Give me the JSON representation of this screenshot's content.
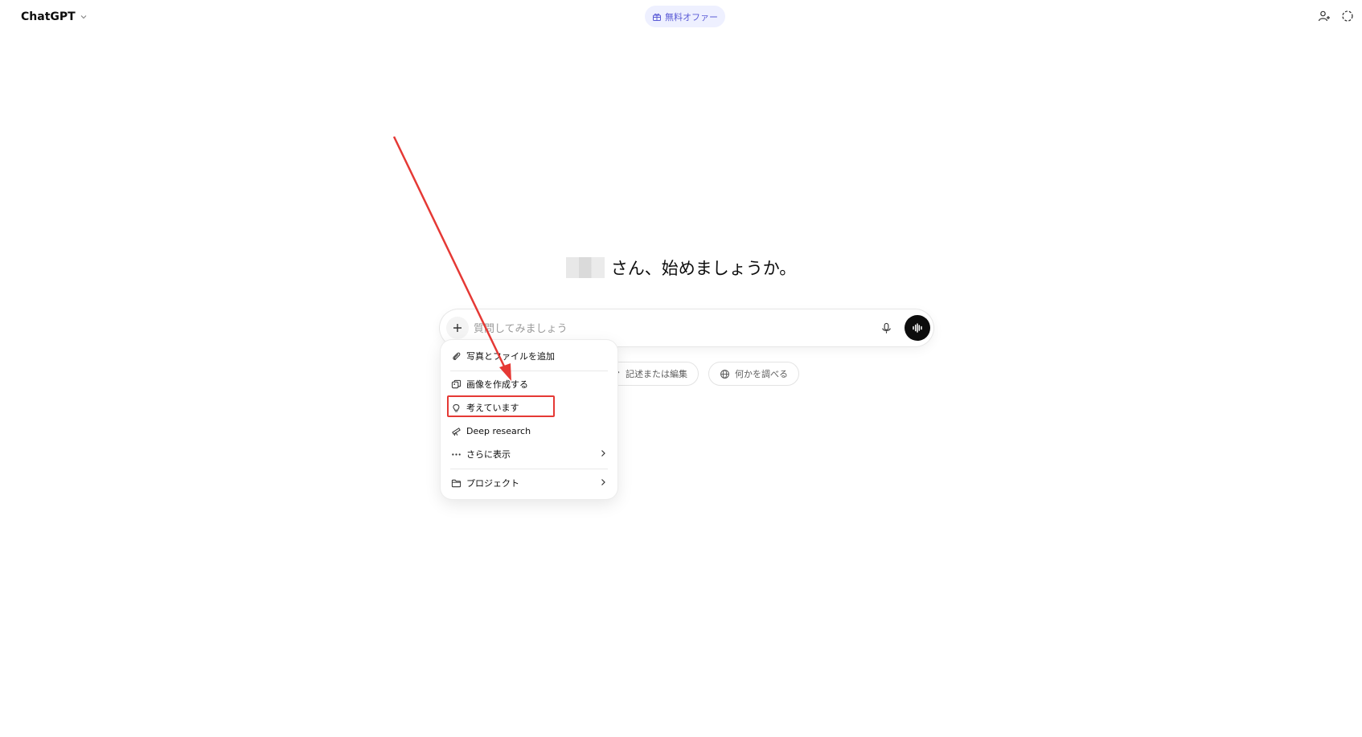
{
  "header": {
    "app_title": "ChatGPT",
    "offer_label": "無料オファー"
  },
  "greeting": {
    "text": "さん、始めましょうか。"
  },
  "composer": {
    "placeholder": "質問してみましょう"
  },
  "chips": [
    {
      "label": "記述または編集",
      "icon": "pencil-icon"
    },
    {
      "label": "何かを調べる",
      "icon": "globe-icon"
    }
  ],
  "menu": {
    "items": [
      {
        "label": "写真とファイルを追加",
        "icon": "paperclip-icon"
      },
      {
        "label": "画像を作成する",
        "icon": "image-icon"
      },
      {
        "label": "考えています",
        "icon": "lightbulb-icon"
      },
      {
        "label": "Deep research",
        "icon": "telescope-icon"
      },
      {
        "label": "さらに表示",
        "icon": "more-dots-icon"
      },
      {
        "label": "プロジェクト",
        "icon": "folder-icon"
      }
    ]
  },
  "annotation": {
    "color": "#e53935"
  },
  "colors": {
    "accent": "#5b5bd6",
    "offer_bg": "#eef0ff",
    "voice_button": "#0d0d0d"
  }
}
